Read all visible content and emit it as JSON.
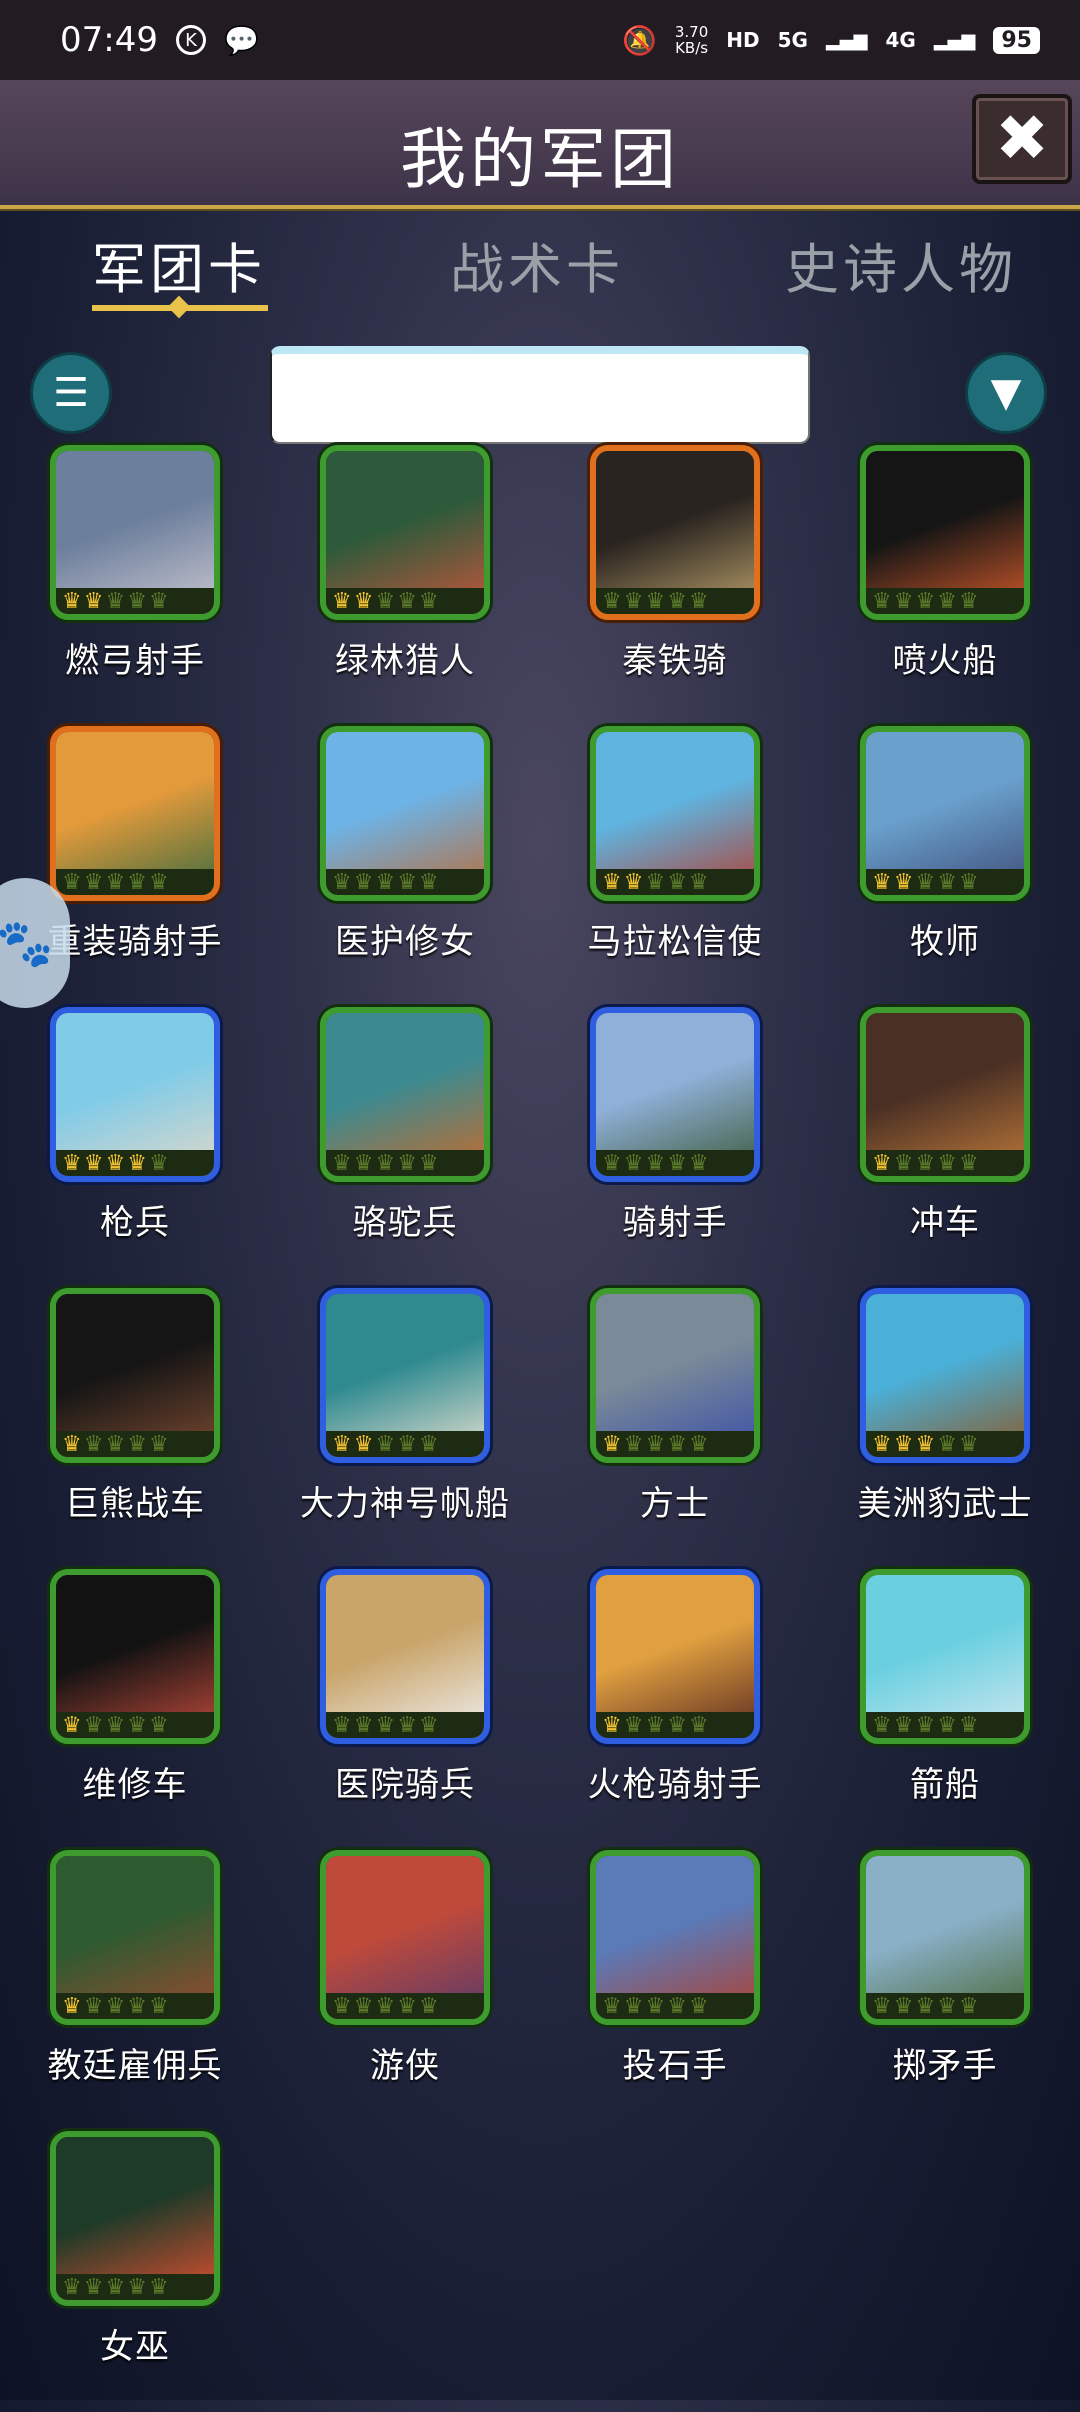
{
  "status_bar": {
    "time": "07:49",
    "speed_top": "3.70",
    "speed_unit": "KB/s",
    "network_tags": [
      "HD",
      "5G",
      "4G"
    ],
    "battery": "95"
  },
  "header": {
    "title": "我的军团",
    "close_label": "✖"
  },
  "tabs": [
    {
      "label": "军团卡",
      "active": true
    },
    {
      "label": "战术卡",
      "active": false
    },
    {
      "label": "史诗人物",
      "active": false
    }
  ],
  "controls": {
    "list_icon": "list-icon",
    "filter_icon": "filter-icon",
    "search_value": ""
  },
  "cards": [
    {
      "name": "燃弓射手",
      "border": "green",
      "crowns": 2,
      "art": [
        "#6c7f9c",
        "#c9c6d0"
      ]
    },
    {
      "name": "绿林猎人",
      "border": "green",
      "crowns": 2,
      "art": [
        "#2d5a3a",
        "#c5563c"
      ]
    },
    {
      "name": "秦铁骑",
      "border": "orange",
      "crowns": 0,
      "art": [
        "#2a2420",
        "#b9a06a"
      ]
    },
    {
      "name": "喷火船",
      "border": "green",
      "crowns": 0,
      "art": [
        "#151515",
        "#d45a2a"
      ]
    },
    {
      "name": "重装骑射手",
      "border": "orange",
      "crowns": 0,
      "art": [
        "#e39a3b",
        "#3b6b3f"
      ]
    },
    {
      "name": "医护修女",
      "border": "green",
      "crowns": 0,
      "art": [
        "#6db3e6",
        "#b86d3c"
      ]
    },
    {
      "name": "马拉松信使",
      "border": "green",
      "crowns": 2,
      "art": [
        "#5fb4e0",
        "#b04034"
      ]
    },
    {
      "name": "牧师",
      "border": "green",
      "crowns": 2,
      "art": [
        "#6aa0cc",
        "#3e4d78"
      ]
    },
    {
      "name": "枪兵",
      "border": "blue",
      "crowns": 4,
      "art": [
        "#7fcbe8",
        "#e0d8c8"
      ]
    },
    {
      "name": "骆驼兵",
      "border": "green",
      "crowns": 0,
      "art": [
        "#3c8a90",
        "#c86a2a"
      ]
    },
    {
      "name": "骑射手",
      "border": "blue",
      "crowns": 0,
      "art": [
        "#8fb0d8",
        "#3c5a3a"
      ]
    },
    {
      "name": "冲车",
      "border": "green",
      "crowns": 1,
      "art": [
        "#4a3024",
        "#c07a3a"
      ]
    },
    {
      "name": "巨熊战车",
      "border": "green",
      "crowns": 1,
      "art": [
        "#151515",
        "#7a4a30"
      ]
    },
    {
      "name": "大力神号帆船",
      "border": "blue",
      "crowns": 2,
      "art": [
        "#2f8a90",
        "#e4e0d0"
      ]
    },
    {
      "name": "方士",
      "border": "green",
      "crowns": 1,
      "art": [
        "#7a8a98",
        "#3a4fa8"
      ]
    },
    {
      "name": "美洲豹武士",
      "border": "blue",
      "crowns": 3,
      "art": [
        "#4ab0d8",
        "#8a5a2a"
      ]
    },
    {
      "name": "维修车",
      "border": "green",
      "crowns": 1,
      "art": [
        "#121212",
        "#c04a3a"
      ]
    },
    {
      "name": "医院骑兵",
      "border": "blue",
      "crowns": 0,
      "art": [
        "#c9a56a",
        "#f0f0f0"
      ]
    },
    {
      "name": "火枪骑射手",
      "border": "blue",
      "crowns": 1,
      "art": [
        "#e0a040",
        "#5a2a20"
      ]
    },
    {
      "name": "箭船",
      "border": "green",
      "crowns": 0,
      "art": [
        "#6ad0e0",
        "#d0e8f0"
      ]
    },
    {
      "name": "教廷雇佣兵",
      "border": "green",
      "crowns": 1,
      "art": [
        "#2e5a30",
        "#9a4a30"
      ]
    },
    {
      "name": "游侠",
      "border": "green",
      "crowns": 0,
      "art": [
        "#c04a3a",
        "#5a3a6a"
      ]
    },
    {
      "name": "投石手",
      "border": "green",
      "crowns": 0,
      "art": [
        "#5a7ab8",
        "#b04030"
      ]
    },
    {
      "name": "掷矛手",
      "border": "green",
      "crowns": 0,
      "art": [
        "#8ab0c8",
        "#4a6a3a"
      ]
    },
    {
      "name": "女巫",
      "border": "green",
      "crowns": 0,
      "art": [
        "#1e3a28",
        "#e05030"
      ]
    }
  ]
}
